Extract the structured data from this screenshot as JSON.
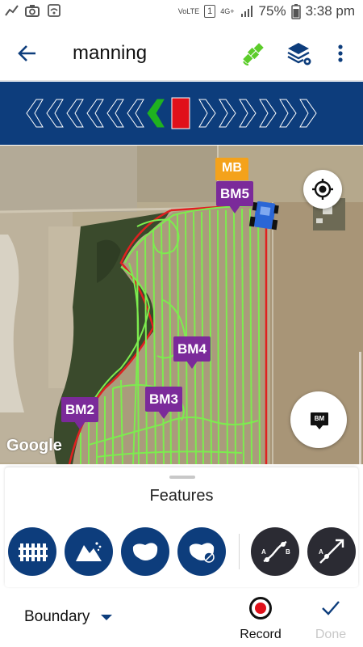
{
  "status_bar": {
    "battery": "75%",
    "time": "3:38 pm",
    "network": "4G+",
    "volte": "VoLTE",
    "sim": "1"
  },
  "app_bar": {
    "title": "manning",
    "icons": [
      "back-arrow-icon",
      "satellite-gps-icon",
      "layers-settings-icon",
      "more-vertical-icon"
    ]
  },
  "lightbar": {
    "left_chevrons": 7,
    "right_chevrons": 6,
    "active_chevron_color": "#1fb21f",
    "center_color": "#e0101a",
    "background": "#0d3d7c"
  },
  "map": {
    "markers": [
      {
        "label": "MB",
        "color": "#f4a21b"
      },
      {
        "label": "BM5",
        "color": "#7b2a9a"
      },
      {
        "label": "BM4",
        "color": "#7b2a9a"
      },
      {
        "label": "BM3",
        "color": "#7b2a9a"
      },
      {
        "label": "BM2",
        "color": "#7b2a9a"
      }
    ],
    "attribution": "Google",
    "bm_button_label": "BM",
    "coverage_color": "#7dec4f",
    "boundary_color": "#e02020"
  },
  "features": {
    "title": "Features",
    "buttons": [
      {
        "icon": "fence-boundary-icon"
      },
      {
        "icon": "rocks-hazard-icon"
      },
      {
        "icon": "area-shape-icon"
      },
      {
        "icon": "area-exclude-icon"
      },
      {
        "icon": "ab-curve-icon"
      },
      {
        "icon": "ab-line-icon"
      }
    ]
  },
  "bottom_bar": {
    "boundary_label": "Boundary",
    "record_label": "Record",
    "done_label": "Done",
    "accent": "#0d3d7c"
  }
}
